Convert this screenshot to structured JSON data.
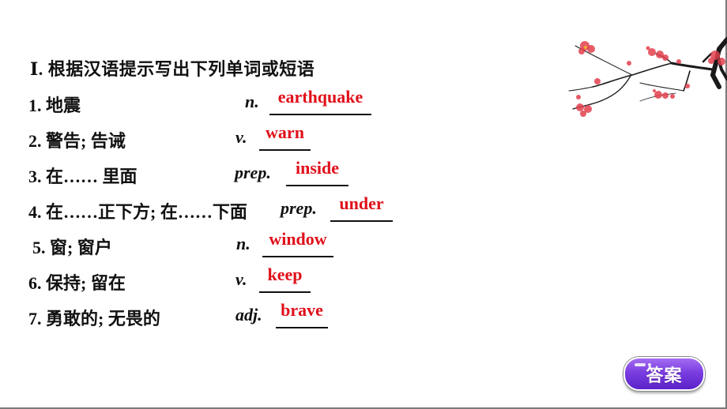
{
  "heading": "Ⅰ. 根据汉语提示写出下列单词或短语",
  "items": [
    {
      "number": "1.",
      "chinese": "地震",
      "pos": "n.",
      "answer": "earthquake"
    },
    {
      "number": "2.",
      "chinese": "警告; 告诫",
      "pos": "v.",
      "answer": "warn"
    },
    {
      "number": "3.",
      "chinese": "在…… 里面",
      "pos": "prep.",
      "answer": "inside"
    },
    {
      "number": "4.",
      "chinese": "在……正下方; 在……下面",
      "pos": "prep.",
      "answer": "under"
    },
    {
      "number": "5.",
      "chinese": "窗; 窗户",
      "pos": "n.",
      "answer": "window"
    },
    {
      "number": "6.",
      "chinese": "保持; 留在",
      "pos": "v.",
      "answer": "keep"
    },
    {
      "number": "7.",
      "chinese": "勇敢的; 无畏的",
      "pos": "adj.",
      "answer": "brave"
    }
  ],
  "answer_button": {
    "label": "答案"
  },
  "colors": {
    "answer_text": "#e0101a",
    "button_purple": "#7a3de0",
    "blossom": "#e2404c"
  }
}
